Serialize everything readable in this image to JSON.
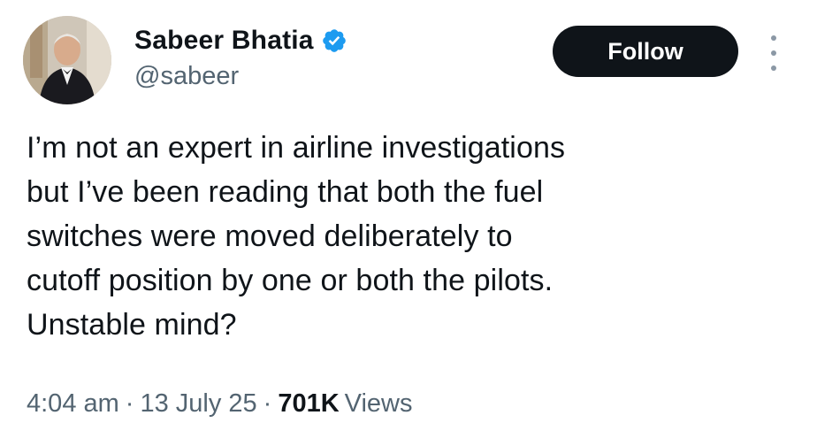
{
  "author": {
    "display_name": "Sabeer Bhatia",
    "handle": "@sabeer",
    "verified": true,
    "verified_color": "#1d9bf0"
  },
  "actions": {
    "follow_label": "Follow",
    "more_icon": "more-vertical-icon"
  },
  "tweet": {
    "lines": [
      "I’m not an expert in airline investigations",
      "but I’ve been reading that both the fuel",
      "switches were moved deliberately to",
      "cutoff position by one or both the pilots.",
      "Unstable mind?"
    ]
  },
  "meta": {
    "time": "4:04 am",
    "date": "13 July 25",
    "separator": "·",
    "views_count": "701K",
    "views_label": "Views"
  },
  "colors": {
    "text_primary": "#0f1419",
    "text_secondary": "#536471",
    "button_bg": "#0f1419",
    "button_text": "#ffffff"
  }
}
